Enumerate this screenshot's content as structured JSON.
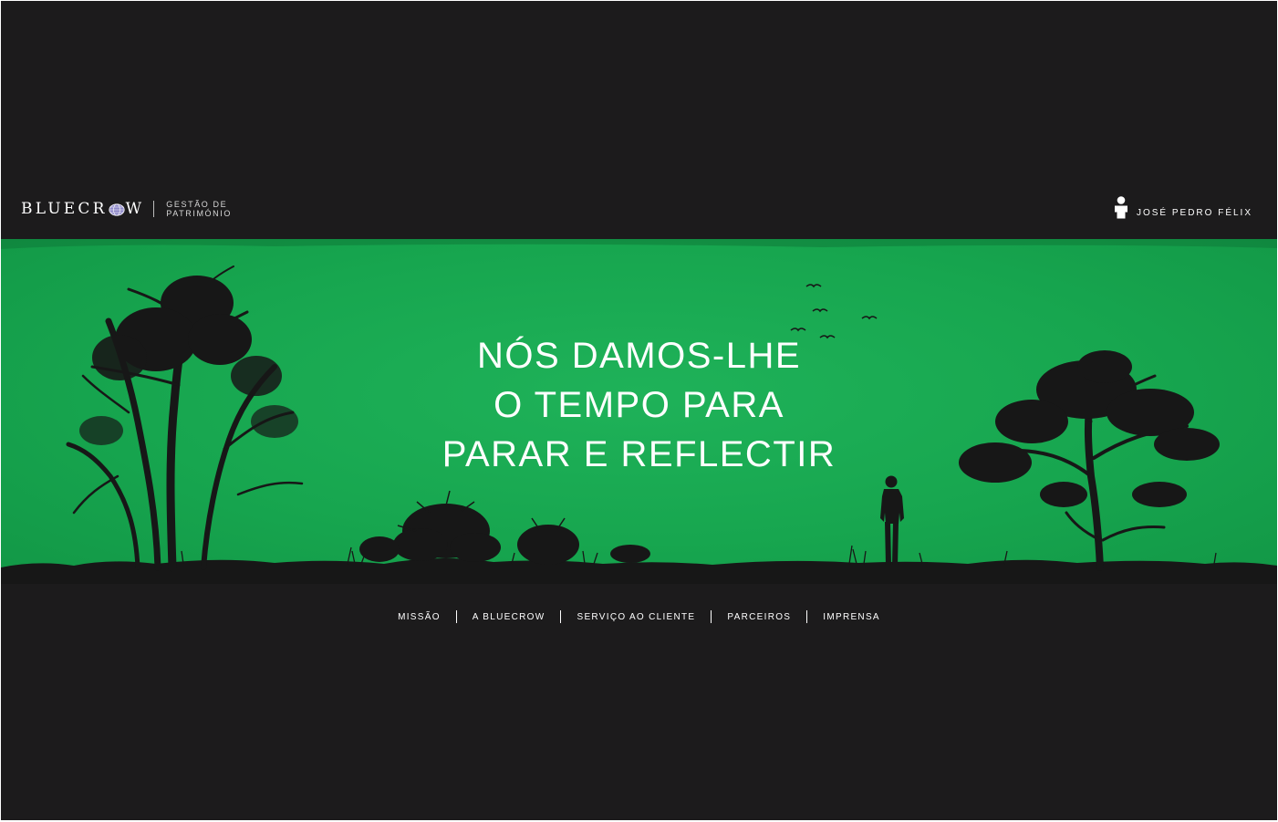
{
  "brand": {
    "name_part1": "BLUECR",
    "name_part2": "W",
    "subtitle_line1": "GESTÃO DE",
    "subtitle_line2": "PATRIMÓNIO",
    "logo_icon": "globe-icon"
  },
  "user": {
    "name": "JOSÉ PEDRO FÉLIX",
    "icon": "user-icon"
  },
  "hero": {
    "headline_line1": "NÓS DAMOS-LHE",
    "headline_line2": "O TEMPO PARA",
    "headline_line3": "PARAR E REFLECTIR",
    "background_color": "#17a64f"
  },
  "nav": {
    "items": [
      "MISSÃO",
      "A BLUECROW",
      "SERVIÇO AO CLIENTE",
      "PARCEIROS",
      "IMPRENSA"
    ]
  },
  "colors": {
    "background": "#1c1b1c",
    "accent": "#1fb259",
    "text": "#ffffff"
  }
}
